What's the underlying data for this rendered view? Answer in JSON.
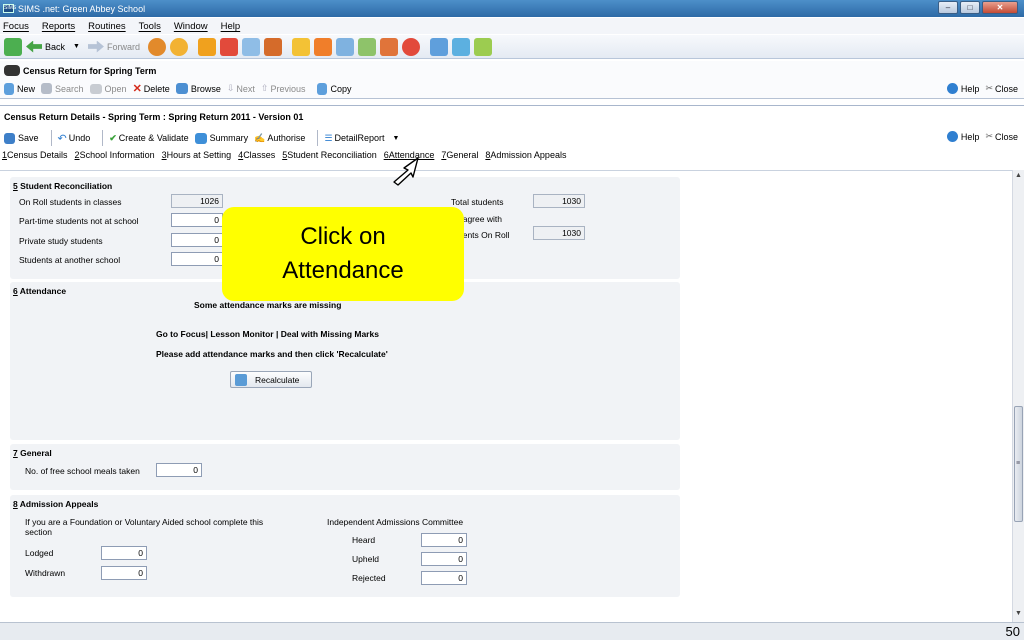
{
  "window": {
    "title": "SIMS .net: Green Abbey School",
    "app_icon": "SIMS"
  },
  "menubar": [
    "Focus",
    "Reports",
    "Routines",
    "Tools",
    "Window",
    "Help"
  ],
  "nav_toolbar": {
    "back": "Back",
    "forward": "Forward"
  },
  "census_return": {
    "title": "Census Return for Spring Term",
    "tools": {
      "new": "New",
      "search": "Search",
      "open": "Open",
      "delete": "Delete",
      "browse": "Browse",
      "next": "Next",
      "previous": "Previous",
      "copy": "Copy"
    },
    "help": "Help",
    "close": "Close"
  },
  "details": {
    "title": "Census Return Details - Spring Term : Spring Return 2011 - Version 01",
    "tools": {
      "save": "Save",
      "undo": "Undo",
      "create_validate": "Create & Validate",
      "summary": "Summary",
      "authorise": "Authorise",
      "detail_report": "DetailReport"
    },
    "help": "Help",
    "close": "Close",
    "tabs": [
      {
        "num": "1",
        "label": "Census Details"
      },
      {
        "num": "2",
        "label": "School Information"
      },
      {
        "num": "3",
        "label": "Hours at Setting"
      },
      {
        "num": "4",
        "label": "Classes"
      },
      {
        "num": "5",
        "label": "Student Reconciliation"
      },
      {
        "num": "6",
        "label": "Attendance"
      },
      {
        "num": "7",
        "label": "General"
      },
      {
        "num": "8",
        "label": "Admission Appeals"
      }
    ]
  },
  "student_reconciliation": {
    "num": "5",
    "title": "Student Reconciliation",
    "on_roll_label": "On Roll students in classes",
    "on_roll_value": "1026",
    "part_time_label": "Part-time students not at school",
    "part_time_value": "0",
    "private_study_label": "Private study students",
    "private_study_value": "0",
    "another_school_label": "Students at another school",
    "another_school_value": "0",
    "total_label": "Total students",
    "total_value": "1030",
    "agree_label": "t agree with",
    "on_roll_label2": "dents On Roll",
    "on_roll_value2": "1030"
  },
  "attendance": {
    "num": "6",
    "title": "Attendance",
    "missing_msg": "Some attendance marks are missing",
    "goto_msg": "Go to Focus| Lesson Monitor | Deal with Missing Marks",
    "add_msg": "Please add attendance marks and then click 'Recalculate'",
    "recalculate": "Recalculate"
  },
  "general": {
    "num": "7",
    "title": "General",
    "fsm_label": "No. of free school meals taken",
    "fsm_value": "0"
  },
  "admission_appeals": {
    "num": "8",
    "title": "Admission Appeals",
    "note": "If you are a Foundation or Voluntary Aided school complete this section",
    "lodged_label": "Lodged",
    "lodged_value": "0",
    "withdrawn_label": "Withdrawn",
    "withdrawn_value": "0",
    "committee_title": "Independent Admissions Committee",
    "heard_label": "Heard",
    "heard_value": "0",
    "upheld_label": "Upheld",
    "upheld_value": "0",
    "rejected_label": "Rejected",
    "rejected_value": "0"
  },
  "callout": {
    "text": "Click on Attendance"
  },
  "page_number": "50"
}
